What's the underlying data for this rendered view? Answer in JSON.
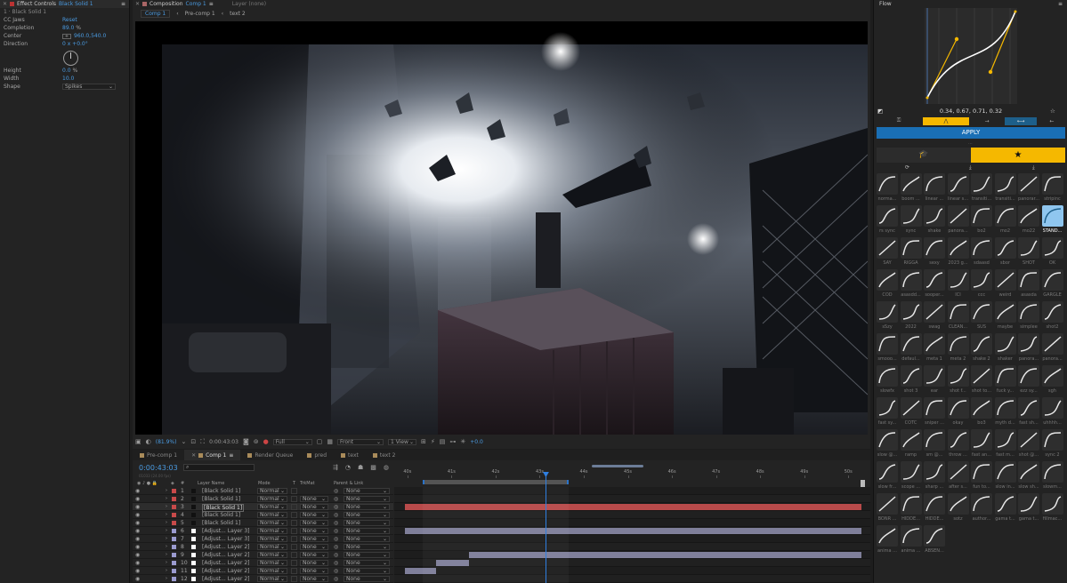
{
  "effect_controls": {
    "tab_label": "Effect Controls",
    "tab_layer": "Black Solid 1",
    "layer_path": "1 · Black Solid 1",
    "effect_name": "CC Jaws",
    "reset_label": "Reset",
    "properties": [
      {
        "label": "Completion",
        "value": "89.0",
        "unit": "%"
      },
      {
        "label": "Center",
        "value": "960.0,540.0",
        "unit": ""
      },
      {
        "label": "Direction",
        "value": "0 x +0.0°",
        "unit": ""
      },
      {
        "label": "Height",
        "value": "0.0",
        "unit": "%"
      },
      {
        "label": "Width",
        "value": "10.0",
        "unit": ""
      },
      {
        "label": "Shape",
        "value": "Spikes",
        "unit": ""
      }
    ]
  },
  "viewer": {
    "composition_tab_label": "Composition",
    "composition_name": "Comp 1",
    "layer_tab_label": "Layer (none)",
    "breadcrumbs": [
      "Comp 1",
      "Pre-comp 1",
      "text 2"
    ],
    "zoom": "(81.9%)",
    "timecode": "0:00:43:03",
    "resolution": "Full",
    "view": "Front",
    "view_count": "1 View",
    "exposure": "+0.0"
  },
  "timeline": {
    "tabs": [
      "Pre-comp 1",
      "Comp 1",
      "Render Queue",
      "pred",
      "text",
      "text 2"
    ],
    "active_tab": "Comp 1",
    "current_time": "0:00:43:03",
    "fps_info": "01033 (24.00 fps)",
    "columns": {
      "num": "#",
      "name": "Layer Name",
      "mode": "Mode",
      "t": "T",
      "trkmat": "TrkMat",
      "parent": "Parent & Link"
    },
    "ruler": [
      "40s",
      "41s",
      "42s",
      "43s",
      "44s",
      "45s",
      "46s",
      "47s",
      "48s",
      "49s",
      "50s"
    ],
    "playhead_seconds": 43.13,
    "work_area": {
      "start": 40.35,
      "end": 43.65
    },
    "layers": [
      {
        "num": "1",
        "name": "[Black Solid 1]",
        "mode": "Normal",
        "trkmat": "",
        "parent": "None",
        "color": "#c84a4a",
        "bar_start": null,
        "bar_end": null,
        "bar_color": ""
      },
      {
        "num": "2",
        "name": "[Black Solid 1]",
        "mode": "Normal",
        "trkmat": "None",
        "parent": "None",
        "color": "#c84a4a",
        "bar_start": null,
        "bar_end": null,
        "bar_color": ""
      },
      {
        "num": "3",
        "name": "[Black Solid 1]",
        "mode": "Normal",
        "trkmat": "None",
        "parent": "None",
        "color": "#c84a4a",
        "bar_start": 39.95,
        "bar_end": 50.4,
        "bar_color": "#b84a4a",
        "selected": true
      },
      {
        "num": "4",
        "name": "[Black Solid 1]",
        "mode": "Normal",
        "trkmat": "None",
        "parent": "None",
        "color": "#c84a4a",
        "bar_start": null,
        "bar_end": null,
        "bar_color": ""
      },
      {
        "num": "5",
        "name": "[Black Solid 1]",
        "mode": "Normal",
        "trkmat": "None",
        "parent": "None",
        "color": "#c84a4a",
        "bar_start": null,
        "bar_end": null,
        "bar_color": ""
      },
      {
        "num": "6",
        "name": "[Adjust... Layer 3]",
        "mode": "Normal",
        "trkmat": "None",
        "parent": "None",
        "color": "#9b9bd0",
        "bar_start": 39.95,
        "bar_end": 50.4,
        "bar_color": "#7f7f9a"
      },
      {
        "num": "7",
        "name": "[Adjust... Layer 3]",
        "mode": "Normal",
        "trkmat": "None",
        "parent": "None",
        "color": "#9b9bd0",
        "bar_start": null,
        "bar_end": null,
        "bar_color": ""
      },
      {
        "num": "8",
        "name": "[Adjust... Layer 2]",
        "mode": "Normal",
        "trkmat": "None",
        "parent": "None",
        "color": "#9b9bd0",
        "bar_start": null,
        "bar_end": null,
        "bar_color": ""
      },
      {
        "num": "9",
        "name": "[Adjust... Layer 2]",
        "mode": "Normal",
        "trkmat": "None",
        "parent": "None",
        "color": "#9b9bd0",
        "bar_start": 41.4,
        "bar_end": 50.4,
        "bar_color": "#7f7f9a"
      },
      {
        "num": "10",
        "name": "[Adjust... Layer 2]",
        "mode": "Normal",
        "trkmat": "None",
        "parent": "None",
        "color": "#9b9bd0",
        "bar_start": 40.65,
        "bar_end": 41.4,
        "bar_color": "#7f7f9a"
      },
      {
        "num": "11",
        "name": "[Adjust... Layer 2]",
        "mode": "Normal",
        "trkmat": "None",
        "parent": "None",
        "color": "#9b9bd0",
        "bar_start": 39.95,
        "bar_end": 40.65,
        "bar_color": "#7f7f9a"
      },
      {
        "num": "12",
        "name": "[Adjust... Layer 2]",
        "mode": "Normal",
        "trkmat": "None",
        "parent": "None",
        "color": "#9b9bd0",
        "bar_start": null,
        "bar_end": null,
        "bar_color": ""
      }
    ]
  },
  "flow": {
    "title": "Flow",
    "curve_values": "0.34, 0.67, 0.71, 0.32",
    "apply_label": "APPLY",
    "accent_color": "#f5b800",
    "apply_color": "#1a6fb5",
    "presets": [
      "norma...",
      "boom ...",
      "linear ...",
      "linear s...",
      "transiti...",
      "transiti...",
      "panorar...",
      "stripinc",
      "rs sync",
      "sync",
      "shake",
      "panora...",
      "bo2",
      "mo2",
      "mo22",
      "STAND...",
      "SAY",
      "RIGGA",
      "sexy",
      "2023 g...",
      "sdaasd",
      "sbor",
      "SHOT",
      "OK",
      "COD",
      "asasdd...",
      "sooper...",
      "ICI",
      "ccc",
      "weird",
      "asasda",
      "GARGLE",
      "sSzy",
      "2022",
      "swag",
      "CLEAN...",
      "SUS",
      "maybe",
      "simplee",
      "shot2",
      "smooo...",
      "defaul...",
      "meta 1",
      "meta 2",
      "shake 2",
      "shaker",
      "panora...",
      "panora...",
      "slowfx",
      "shot 3",
      "ear",
      "shot f...",
      "shot to...",
      "fuck y...",
      "ezz sy...",
      "sgh",
      "fast sy...",
      "COTC",
      "sniper ...",
      "okay",
      "bo3",
      "myth d...",
      "fast sh...",
      "uhhhh...",
      "slow @...",
      "ramp",
      "sm @...",
      "throw ...",
      "fast an...",
      "fast m...",
      "shot @...",
      "sync 2",
      "slow fr...",
      "scope ...",
      "sharp ...",
      "after s...",
      "fun to...",
      "slow in...",
      "slow sh...",
      "slowm...",
      "BONR ...",
      "HIDDE...",
      "HIDDE...",
      "sotz",
      "author...",
      "gama t...",
      "gama t...",
      "fillmac...",
      "anima ...",
      "anima ...",
      "ABSEN..."
    ],
    "selected_preset": 15
  }
}
